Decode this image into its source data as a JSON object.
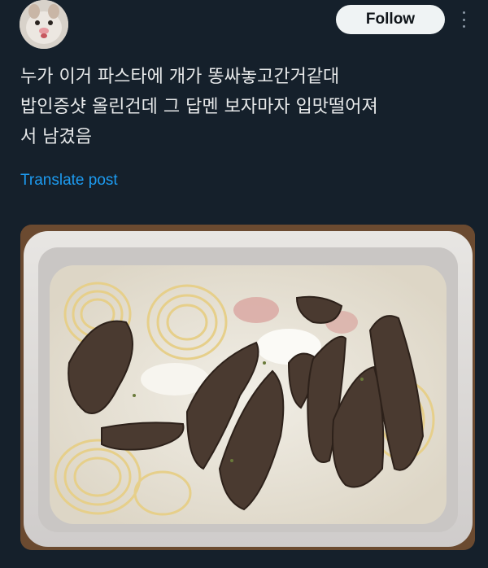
{
  "header": {
    "follow_label": "Follow"
  },
  "post": {
    "text_lines": [
      "누가 이거 파스타에 개가 똥싸놓고간거같대",
      "밥인증샷 올린건데 그 답멘 보자마자 입맛떨어져",
      "서 남겼음"
    ],
    "translate_label": "Translate post"
  },
  "colors": {
    "background": "#15202b",
    "text": "#e7e9ea",
    "link": "#1d9bf0",
    "follow_bg": "#eff3f4"
  },
  "icons": [
    "avatar",
    "more-icon"
  ]
}
